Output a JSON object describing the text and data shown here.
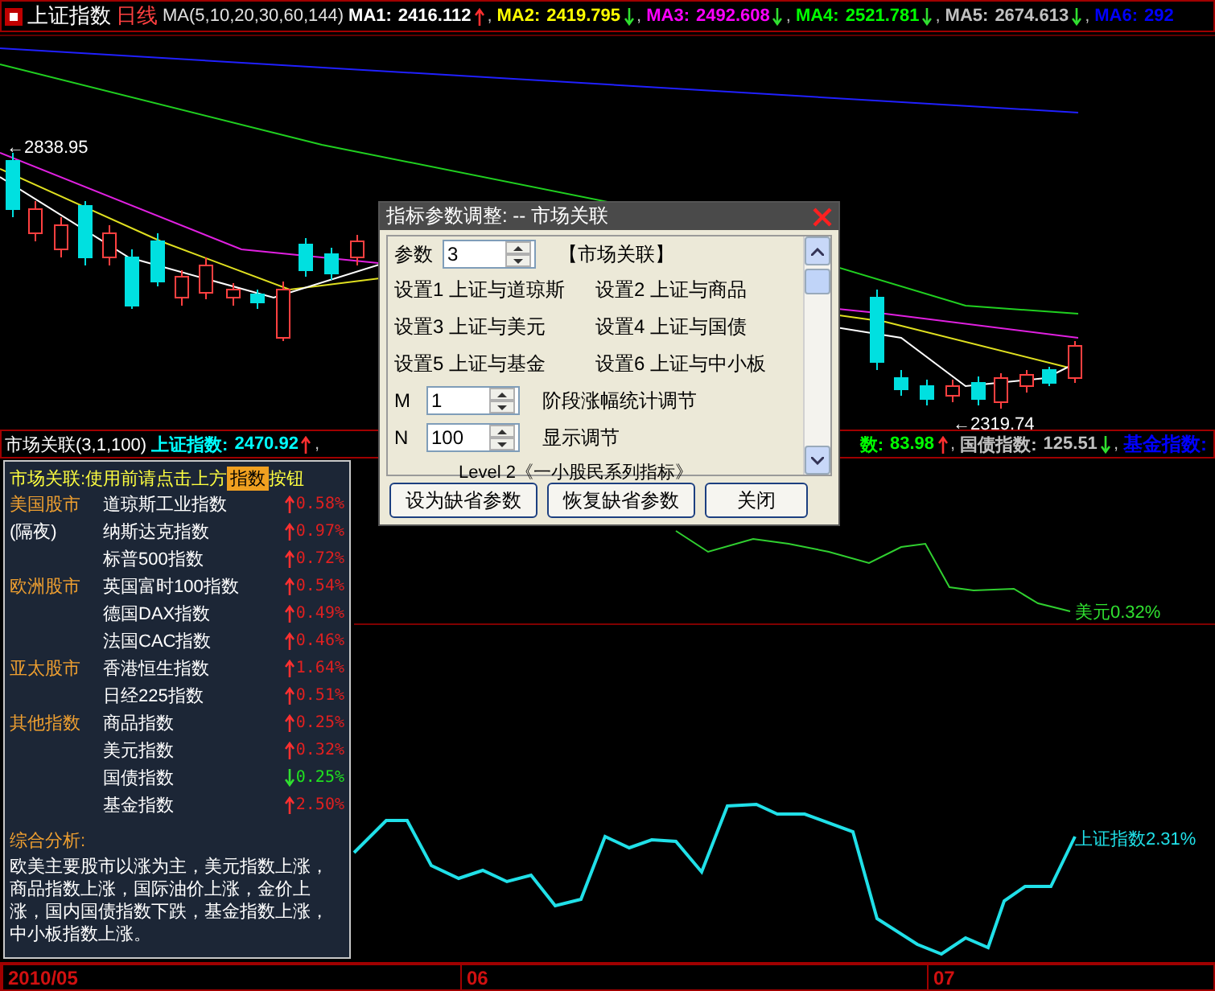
{
  "top_bar": {
    "title": "上证指数",
    "period": "日线",
    "indicator": "MA(5,10,20,30,60,144)",
    "values": [
      {
        "label": "MA1:",
        "value": "2416.112",
        "rising": true,
        "suffix": ",",
        "color": "#ffffff"
      },
      {
        "label": "MA2:",
        "value": "2419.795",
        "rising": false,
        "suffix": ",",
        "color": "#ffff00"
      },
      {
        "label": "MA3:",
        "value": "2492.608",
        "rising": false,
        "suffix": ",",
        "color": "#ff00ff"
      },
      {
        "label": "MA4:",
        "value": "2521.781",
        "rising": false,
        "suffix": ",",
        "color": "#00ff00"
      },
      {
        "label": "MA5:",
        "value": "2674.613",
        "rising": false,
        "suffix": ",",
        "color": "#c0c0c0"
      },
      {
        "label": "MA6:",
        "value": "292",
        "color": "#0000ff"
      }
    ]
  },
  "price_chart": {
    "high_label": "←2838.95",
    "low_label": "←2319.74"
  },
  "indicator_bar": {
    "name": "市场关联(3,1,100)",
    "left_values": [
      {
        "label": "上证指数:",
        "value": "2470.92",
        "rising": true,
        "suffix": ",",
        "color": "#00ffff"
      }
    ],
    "right_values": [
      {
        "label": "数:",
        "value": "83.98",
        "rising": true,
        "suffix": ",",
        "color": "#00ff00"
      },
      {
        "label": "国债指数:",
        "value": "125.51",
        "rising": false,
        "suffix": ",",
        "color": "#c0c0c0"
      },
      {
        "label": "基金指数:",
        "color": "#0000ff"
      }
    ]
  },
  "correlation_chart": {
    "usd_label": "美元0.32%",
    "index_label": "上证指数2.31%"
  },
  "market_panel": {
    "title": "市场关联:使用前请点击上方",
    "title_highlight": "指数",
    "title_end": "按钮",
    "groups": [
      {
        "name": "美国股市",
        "note": "(隔夜)",
        "indices": [
          {
            "name": "道琼斯工业指数",
            "change": "0.58%",
            "rising": true
          },
          {
            "name": "纳斯达克指数",
            "change": "0.97%",
            "rising": true
          },
          {
            "name": "标普500指数",
            "change": "0.72%",
            "rising": true
          }
        ]
      },
      {
        "name": "欧洲股市",
        "indices": [
          {
            "name": "英国富时100指数",
            "change": "0.54%",
            "rising": true
          },
          {
            "name": "德国DAX指数",
            "change": "0.49%",
            "rising": true
          },
          {
            "name": "法国CAC指数",
            "change": "0.46%",
            "rising": true
          }
        ]
      },
      {
        "name": "亚太股市",
        "indices": [
          {
            "name": "香港恒生指数",
            "change": "1.64%",
            "rising": true
          },
          {
            "name": "日经225指数",
            "change": "0.51%",
            "rising": true
          }
        ]
      },
      {
        "name": "其他指数",
        "indices": [
          {
            "name": "商品指数",
            "change": "0.25%",
            "rising": true
          },
          {
            "name": "美元指数",
            "change": "0.32%",
            "rising": true
          },
          {
            "name": "国债指数",
            "change": "0.25%",
            "rising": false
          },
          {
            "name": "基金指数",
            "change": "2.50%",
            "rising": true
          }
        ]
      }
    ],
    "summary_title": "综合分析:",
    "summary": "欧美主要股市以涨为主，美元指数上涨，商品指数上涨，国际油价上涨，金价上涨，国内国债指数下跌，基金指数上涨，中小板指数上涨。"
  },
  "time_axis": [
    "2010/05",
    "06",
    "07"
  ],
  "dialog": {
    "title": "指标参数调整: -- 市场关联",
    "param": {
      "label": "参数",
      "value": "3"
    },
    "heading": "【市场关联】",
    "settings": [
      {
        "label": "设置1",
        "value": "上证与道琼斯"
      },
      {
        "label": "设置2",
        "value": "上证与商品"
      },
      {
        "label": "设置3",
        "value": "上证与美元"
      },
      {
        "label": "设置4",
        "value": "上证与国债"
      },
      {
        "label": "设置5",
        "value": "上证与基金"
      },
      {
        "label": "设置6",
        "value": "上证与中小板"
      }
    ],
    "options": [
      {
        "label": "M",
        "value": "1",
        "description": "阶段涨幅统计调节"
      },
      {
        "label": "N",
        "value": "100",
        "description": "显示调节"
      }
    ],
    "footer": "Level 2《一小股民系列指标》",
    "buttons": [
      "设为缺省参数",
      "恢复缺省参数",
      "关闭"
    ]
  }
}
